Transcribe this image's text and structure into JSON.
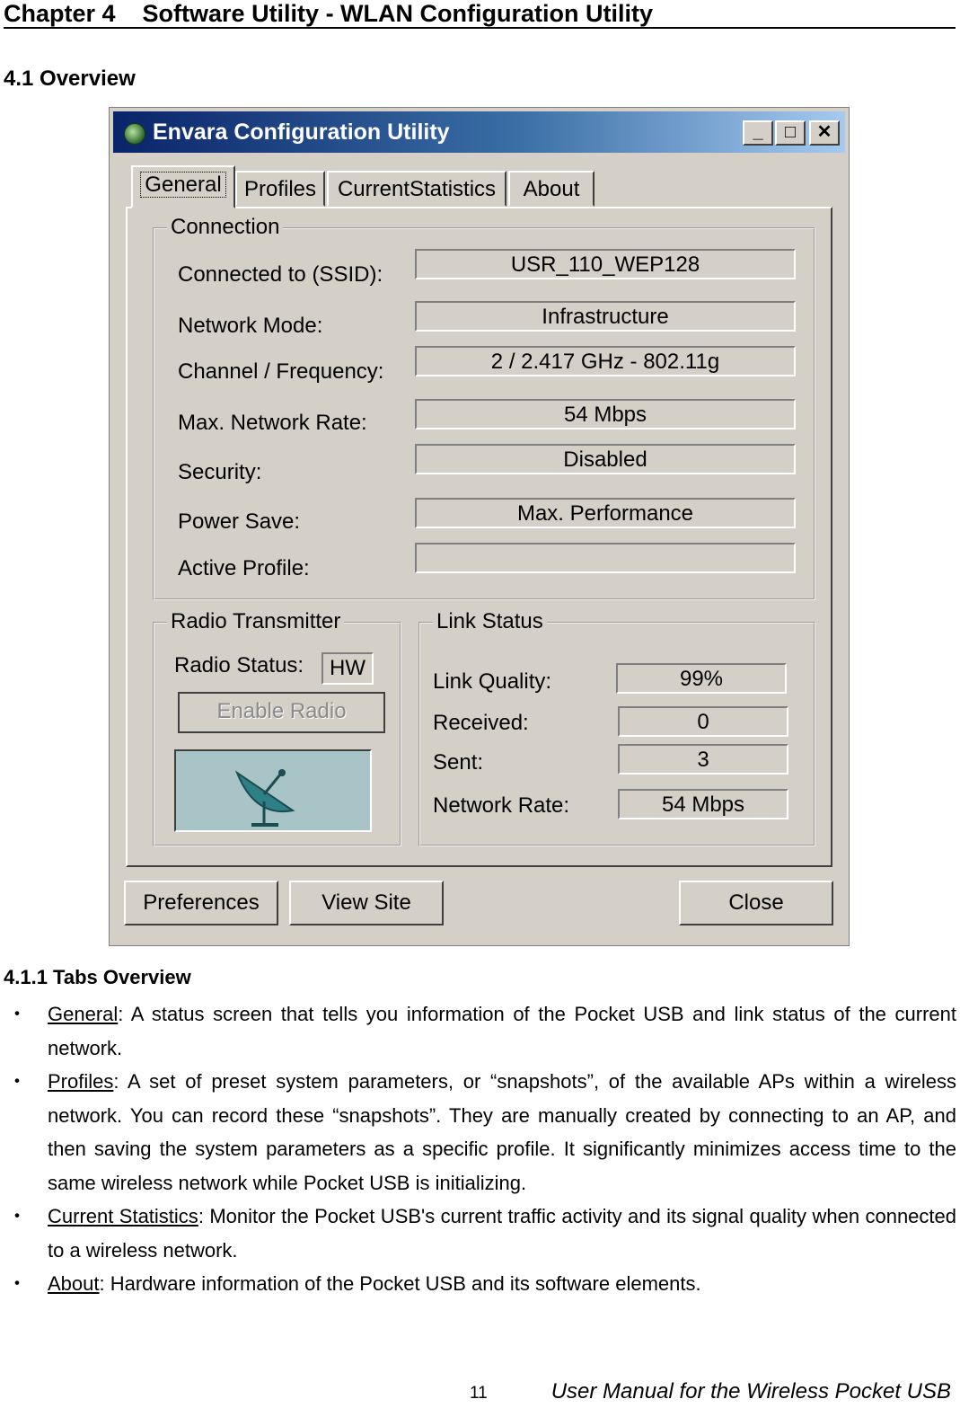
{
  "header": {
    "chapter": "Chapter 4    Software Utility - WLAN Configuration Utility",
    "section": "4.1 Overview"
  },
  "window": {
    "title": "Envara Configuration Utility",
    "controls": {
      "minimize": "_",
      "maximize": "□",
      "close": "✕"
    },
    "tabs": [
      {
        "label": "General",
        "active": true
      },
      {
        "label": "Profiles",
        "active": false
      },
      {
        "label": "CurrentStatistics",
        "active": false
      },
      {
        "label": "About",
        "active": false
      }
    ],
    "connection": {
      "legend": "Connection",
      "rows": [
        {
          "label": "Connected to (SSID):",
          "value": "USR_110_WEP128"
        },
        {
          "label": "Network Mode:",
          "value": "Infrastructure"
        },
        {
          "label": "Channel / Frequency:",
          "value": "2 / 2.417 GHz - 802.11g"
        },
        {
          "label": "Max. Network Rate:",
          "value": "54 Mbps"
        },
        {
          "label": "Security:",
          "value": "Disabled"
        },
        {
          "label": "Power Save:",
          "value": "Max. Performance"
        },
        {
          "label": "Active Profile:",
          "value": ""
        }
      ]
    },
    "radio": {
      "legend": "Radio Transmitter",
      "status_label": "Radio Status:",
      "status_value": "HW",
      "enable_button": "Enable Radio",
      "icon": "satellite-dish-icon"
    },
    "link": {
      "legend": "Link Status",
      "rows": [
        {
          "label": "Link Quality:",
          "value": "99%"
        },
        {
          "label": "Received:",
          "value": "0"
        },
        {
          "label": "Sent:",
          "value": "3"
        },
        {
          "label": "Network Rate:",
          "value": "54 Mbps"
        }
      ]
    },
    "buttons": {
      "preferences": "Preferences",
      "view_site": "View Site",
      "close": "Close"
    }
  },
  "tabs_overview": {
    "heading": "4.1.1 Tabs Overview",
    "bullet": "・",
    "items": [
      {
        "term": "General",
        "text": ": A status screen that tells you information of the Pocket USB and link status of the current network."
      },
      {
        "term": "Profiles",
        "text": ": A set of preset system parameters, or “snapshots”, of the available APs within a wireless network. You can record these “snapshots”. They are manually created by connecting to an AP, and then saving the system parameters as a specific profile. It significantly minimizes access time to the same wireless network while Pocket USB is initializing."
      },
      {
        "term": "Current Statistics",
        "text": ": Monitor the Pocket USB's current traffic activity and its signal quality when connected to a wireless network."
      },
      {
        "term": "About",
        "text": ": Hardware information of the Pocket USB and its software elements."
      }
    ]
  },
  "footer": {
    "page_number": "11",
    "manual_title": "User Manual for the Wireless Pocket USB"
  }
}
